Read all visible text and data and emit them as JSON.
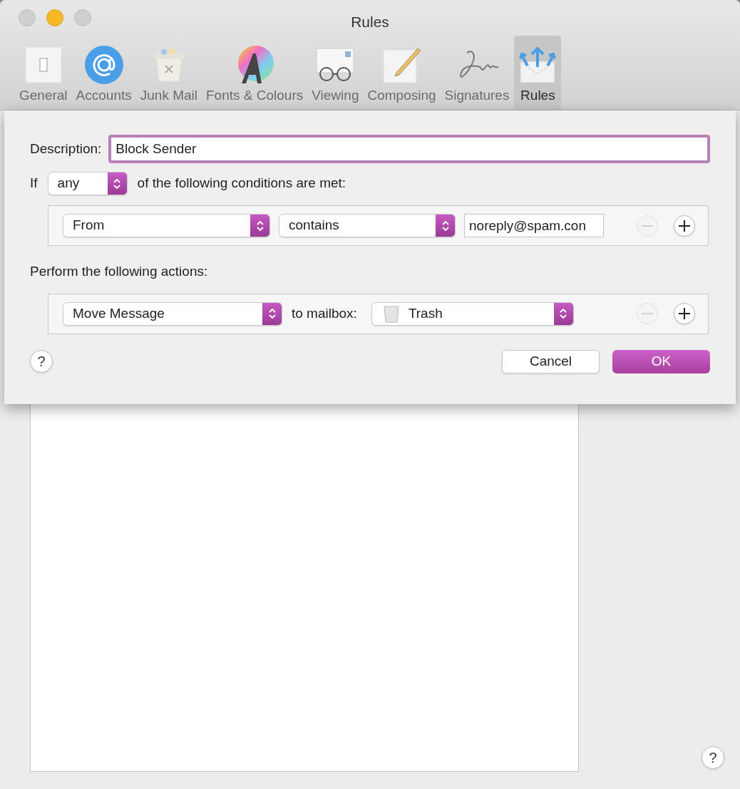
{
  "window": {
    "title": "Rules"
  },
  "toolbar": [
    {
      "label": "General",
      "kind": "switch",
      "selected": false
    },
    {
      "label": "Accounts",
      "kind": "at",
      "selected": false
    },
    {
      "label": "Junk Mail",
      "kind": "bin",
      "selected": false
    },
    {
      "label": "Fonts & Colours",
      "kind": "font",
      "selected": false
    },
    {
      "label": "Viewing",
      "kind": "glasses",
      "selected": false
    },
    {
      "label": "Composing",
      "kind": "pencil",
      "selected": false
    },
    {
      "label": "Signatures",
      "kind": "signature",
      "selected": false
    },
    {
      "label": "Rules",
      "kind": "rules",
      "selected": true
    }
  ],
  "sheet": {
    "description_label": "Description:",
    "description": "Block Sender",
    "if_label": "If",
    "match": "any",
    "conditions_label": "of the following conditions are met:",
    "conditions": [
      {
        "field": "From",
        "operator": "contains",
        "value": "noreply@spam.con",
        "remove_disabled": true,
        "add_disabled": false
      }
    ],
    "actions_label": "Perform the following actions:",
    "actions": [
      {
        "action": "Move Message",
        "target_label": "to mailbox:",
        "mailbox": "Trash",
        "remove_disabled": true,
        "add_disabled": false
      }
    ],
    "help": "?",
    "cancel": "Cancel",
    "ok": "OK"
  },
  "window_help": "?"
}
